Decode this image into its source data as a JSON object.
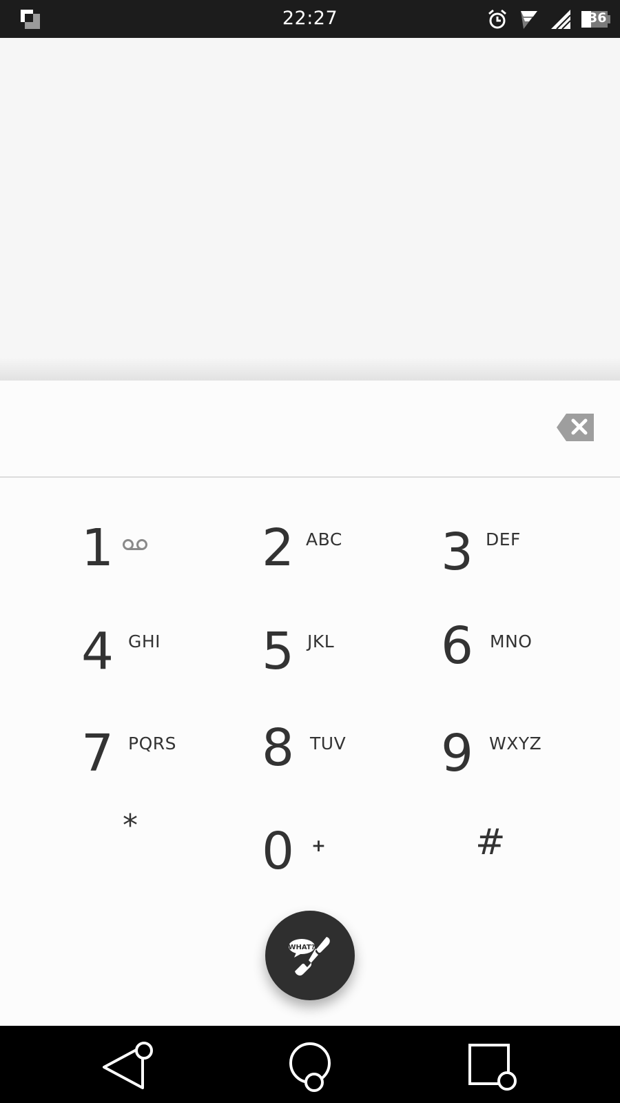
{
  "status_bar": {
    "time": "22:27",
    "battery_level": "36",
    "icons": [
      "screenshot-icon",
      "alarm-icon",
      "wifi-icon",
      "signal-icon",
      "battery-icon"
    ]
  },
  "dialpad": {
    "input_value": "",
    "keys": [
      {
        "digit": "1",
        "letters": "",
        "icon": "voicemail-icon"
      },
      {
        "digit": "2",
        "letters": "ABC"
      },
      {
        "digit": "3",
        "letters": "DEF"
      },
      {
        "digit": "4",
        "letters": "GHI"
      },
      {
        "digit": "5",
        "letters": "JKL"
      },
      {
        "digit": "6",
        "letters": "MNO"
      },
      {
        "digit": "7",
        "letters": "PQRS"
      },
      {
        "digit": "8",
        "letters": "TUV"
      },
      {
        "digit": "9",
        "letters": "WXYZ"
      },
      {
        "digit": "*",
        "letters": ""
      },
      {
        "digit": "0",
        "letters": "+"
      },
      {
        "digit": "#",
        "letters": ""
      }
    ]
  },
  "call_button": {
    "badge_text": "WHAT?"
  },
  "nav_bar": {
    "buttons": [
      "back-icon",
      "home-icon",
      "recents-icon"
    ]
  },
  "colors": {
    "status_bar": "#1c1c1c",
    "dialpad_bg": "#fcfcfc",
    "digit_text": "#333333",
    "fab": "#2f2f2f",
    "nav_bar": "#000000"
  }
}
